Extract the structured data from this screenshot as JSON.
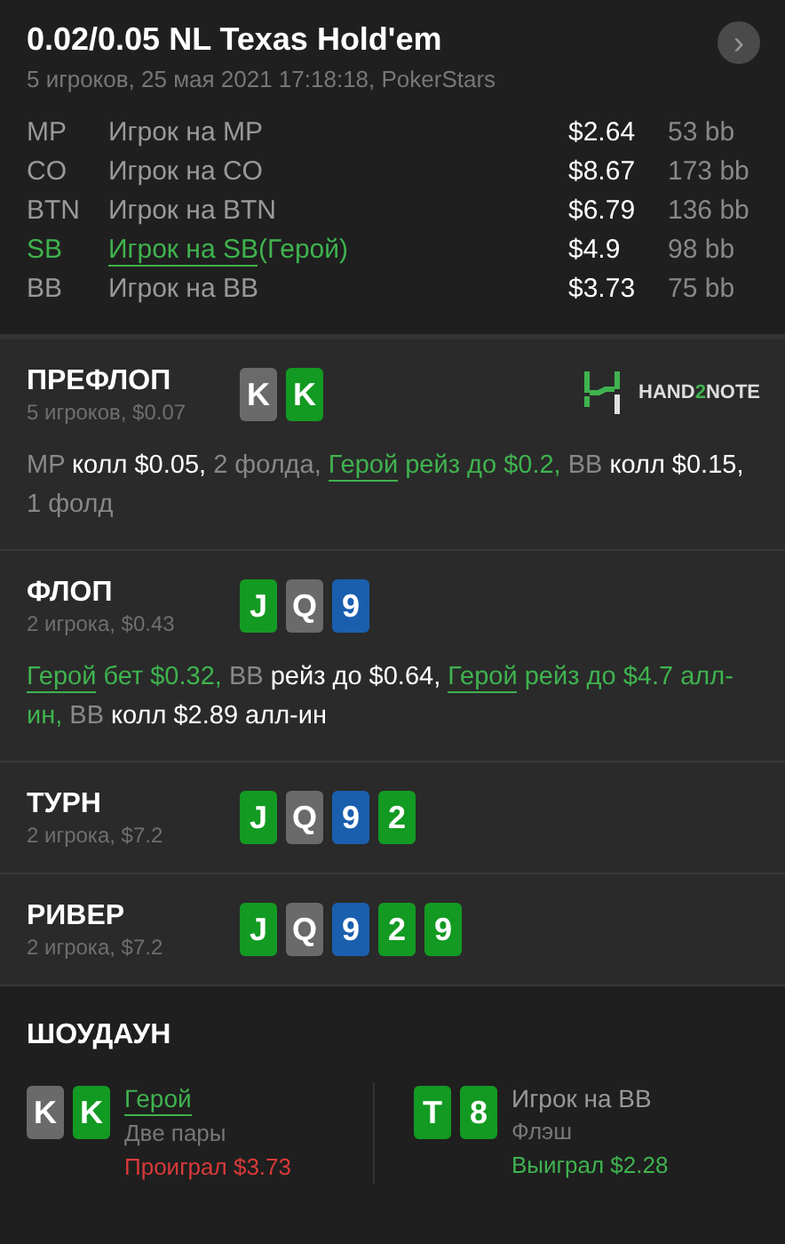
{
  "header": {
    "title": "0.02/0.05 NL Texas Hold'em",
    "subtitle": "5 игроков, 25 мая 2021 17:18:18, PokerStars",
    "next_button": "›"
  },
  "players": [
    {
      "position": "MP",
      "name": "Игрок на MP",
      "hero": false,
      "stack": "$2.64",
      "bb": "53 bb"
    },
    {
      "position": "CO",
      "name": "Игрок на CO",
      "hero": false,
      "stack": "$8.67",
      "bb": "173 bb"
    },
    {
      "position": "BTN",
      "name": "Игрок на BTN",
      "hero": false,
      "stack": "$6.79",
      "bb": "136 bb"
    },
    {
      "position": "SB",
      "name": "Игрок на SB",
      "hero": true,
      "hero_tag": "(Герой)",
      "stack": "$4.9",
      "bb": "98 bb"
    },
    {
      "position": "BB",
      "name": "Игрок на BB",
      "hero": false,
      "stack": "$3.73",
      "bb": "75 bb"
    }
  ],
  "streets": [
    {
      "name": "ПРЕФЛОП",
      "info": "5 игроков, $0.07",
      "cards": [
        {
          "rank": "K",
          "color": "#6a6a6a"
        },
        {
          "rank": "K",
          "color": "#139a22"
        }
      ],
      "logo": {
        "prefix": "HAND",
        "accent": "2",
        "suffix": "NOTE"
      },
      "actions": [
        {
          "kind": "pos",
          "text": "MP"
        },
        {
          "kind": "act",
          "text": " колл $0.05,"
        },
        {
          "kind": "fold",
          "text": " 2 фолда, "
        },
        {
          "kind": "hero",
          "text": "Герой"
        },
        {
          "kind": "heroact",
          "text": " рейз до $0.2,"
        },
        {
          "kind": "pos",
          "text": " BB"
        },
        {
          "kind": "act",
          "text": " колл $0.15,"
        },
        {
          "kind": "fold",
          "text": " 1 фолд"
        }
      ]
    },
    {
      "name": "ФЛОП",
      "info": "2 игрока, $0.43",
      "cards": [
        {
          "rank": "J",
          "color": "#139a22"
        },
        {
          "rank": "Q",
          "color": "#6a6a6a"
        },
        {
          "rank": "9",
          "color": "#1a5fae"
        }
      ],
      "actions": [
        {
          "kind": "hero",
          "text": "Герой"
        },
        {
          "kind": "heroact",
          "text": " бет $0.32,"
        },
        {
          "kind": "pos",
          "text": " BB"
        },
        {
          "kind": "act",
          "text": " рейз до $0.64, "
        },
        {
          "kind": "hero",
          "text": "Герой"
        },
        {
          "kind": "heroact",
          "text": " рейз до $4.7 алл-ин,"
        },
        {
          "kind": "pos",
          "text": " BB"
        },
        {
          "kind": "act",
          "text": " колл $2.89 алл-ин"
        }
      ]
    },
    {
      "name": "ТУРН",
      "info": "2 игрока, $7.2",
      "cards": [
        {
          "rank": "J",
          "color": "#139a22"
        },
        {
          "rank": "Q",
          "color": "#6a6a6a"
        },
        {
          "rank": "9",
          "color": "#1a5fae"
        },
        {
          "rank": "2",
          "color": "#139a22"
        }
      ]
    },
    {
      "name": "РИВЕР",
      "info": "2 игрока, $7.2",
      "cards": [
        {
          "rank": "J",
          "color": "#139a22"
        },
        {
          "rank": "Q",
          "color": "#6a6a6a"
        },
        {
          "rank": "9",
          "color": "#1a5fae"
        },
        {
          "rank": "2",
          "color": "#139a22"
        },
        {
          "rank": "9",
          "color": "#139a22"
        }
      ]
    }
  ],
  "showdown": {
    "title": "ШОУДАУН",
    "players": [
      {
        "name": "Герой",
        "hero": true,
        "hand": "Две пары",
        "result": "Проиграл $3.73",
        "won": false,
        "cards": [
          {
            "rank": "K",
            "color": "#6a6a6a"
          },
          {
            "rank": "K",
            "color": "#139a22"
          }
        ]
      },
      {
        "name": "Игрок на BB",
        "hero": false,
        "hand": "Флэш",
        "result": "Выиграл $2.28",
        "won": true,
        "cards": [
          {
            "rank": "T",
            "color": "#139a22"
          },
          {
            "rank": "8",
            "color": "#139a22"
          }
        ]
      }
    ]
  }
}
